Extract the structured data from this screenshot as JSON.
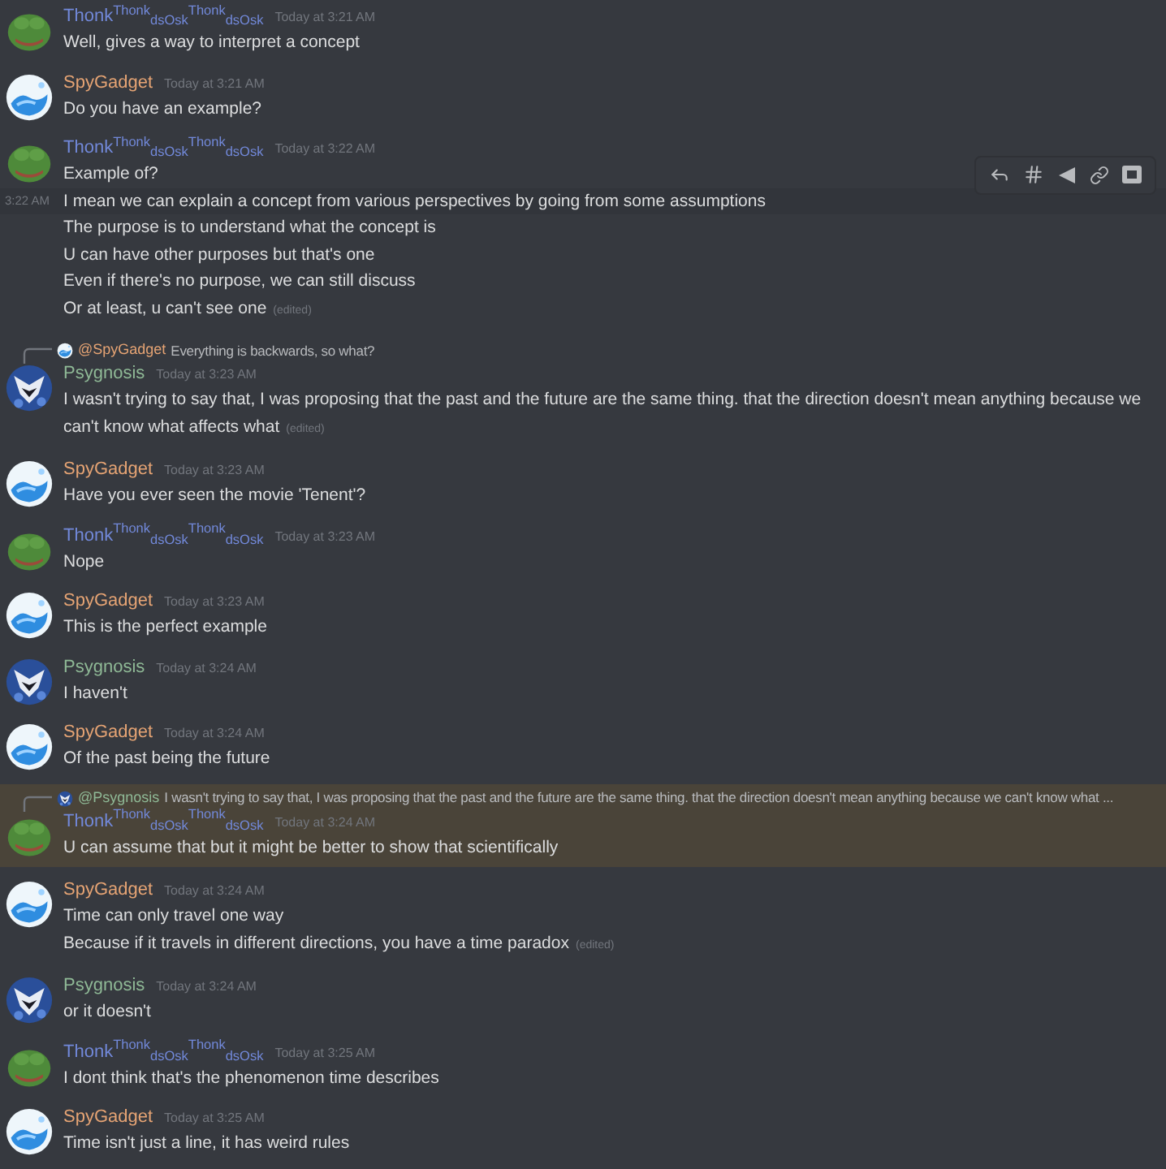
{
  "messages": [
    {
      "author": "Thonk$^{Thonk}$$_{dsOsk}$$^{Thonk}$$_{dsOsk}$",
      "color": "#7289da",
      "kind": "frog",
      "time": "Today at 3:21 AM",
      "highlighted": false,
      "lines": [
        {
          "text": "Well, gives a way to interpret a concept",
          "hovered": false
        }
      ]
    },
    {
      "author": "SpyGadget",
      "color": "#e6a474",
      "kind": "water",
      "time": "Today at 3:21 AM",
      "highlighted": false,
      "lines": [
        {
          "text": "Do you have an example?",
          "hovered": false
        }
      ]
    },
    {
      "author": "Thonk$^{Thonk}$$_{dsOsk}$$^{Thonk}$$_{dsOsk}$",
      "color": "#7289da",
      "kind": "frog",
      "time": "Today at 3:22 AM",
      "highlighted": false,
      "lines": [
        {
          "text": "Example of?",
          "hovered": false
        },
        {
          "text": "I mean we can explain a concept from various perspectives by going from some assumptions",
          "hovered": true,
          "side_time": "3:22 AM"
        },
        {
          "text": "The purpose is to understand what the concept is",
          "hovered": false
        },
        {
          "text": "U can have other purposes but that's one",
          "hovered": false
        },
        {
          "text": "Even if there's no purpose, we can still discuss",
          "hovered": false
        },
        {
          "text": "Or at least, u can't see one",
          "hovered": false,
          "edited_tag": "(edited)"
        }
      ]
    },
    {
      "reply": {
        "author": "@SpyGadget",
        "color": "#e6a474",
        "kind": "water",
        "text": "Everything is backwards, so what?"
      },
      "author": "Psygnosis",
      "color": "#8fb996",
      "kind": "owl",
      "time": "Today at 3:23 AM",
      "highlighted": false,
      "lines": [
        {
          "text": "I wasn't trying to say that, I was proposing that the past and the future are the same thing. that the direction doesn't mean anything because we can't know what affects what",
          "hovered": false,
          "edited_tag": "(edited)"
        }
      ]
    },
    {
      "author": "SpyGadget",
      "color": "#e6a474",
      "kind": "water",
      "time": "Today at 3:23 AM",
      "highlighted": false,
      "lines": [
        {
          "text": "Have you ever seen the movie 'Tenent'?",
          "hovered": false
        }
      ]
    },
    {
      "author": "Thonk$^{Thonk}$$_{dsOsk}$$^{Thonk}$$_{dsOsk}$",
      "color": "#7289da",
      "kind": "frog",
      "time": "Today at 3:23 AM",
      "highlighted": false,
      "lines": [
        {
          "text": "Nope",
          "hovered": false
        }
      ]
    },
    {
      "author": "SpyGadget",
      "color": "#e6a474",
      "kind": "water",
      "time": "Today at 3:23 AM",
      "highlighted": false,
      "lines": [
        {
          "text": "This is the perfect example",
          "hovered": false
        }
      ]
    },
    {
      "author": "Psygnosis",
      "color": "#8fb996",
      "kind": "owl",
      "time": "Today at 3:24 AM",
      "highlighted": false,
      "lines": [
        {
          "text": "I haven't",
          "hovered": false
        }
      ]
    },
    {
      "author": "SpyGadget",
      "color": "#e6a474",
      "kind": "water",
      "time": "Today at 3:24 AM",
      "highlighted": false,
      "lines": [
        {
          "text": "Of the past being the future",
          "hovered": false
        }
      ]
    },
    {
      "reply": {
        "author": "@Psygnosis",
        "color": "#8fb996",
        "kind": "owl",
        "text": "I wasn't trying to say that, I was proposing that the past and the future are the same thing. that the direction doesn't mean anything because we can't know what ..."
      },
      "author": "Thonk$^{Thonk}$$_{dsOsk}$$^{Thonk}$$_{dsOsk}$",
      "color": "#7289da",
      "kind": "frog",
      "time": "Today at 3:24 AM",
      "highlighted": true,
      "lines": [
        {
          "text": "U can assume that but it might be better to show that scientifically",
          "hovered": false
        }
      ]
    },
    {
      "author": "SpyGadget",
      "color": "#e6a474",
      "kind": "water",
      "time": "Today at 3:24 AM",
      "highlighted": false,
      "lines": [
        {
          "text": "Time can only travel one way",
          "hovered": false
        },
        {
          "text": "Because if it travels in different directions, you have a time paradox",
          "hovered": false,
          "edited_tag": "(edited)"
        }
      ]
    },
    {
      "author": "Psygnosis",
      "color": "#8fb996",
      "kind": "owl",
      "time": "Today at 3:24 AM",
      "highlighted": false,
      "lines": [
        {
          "text": "or it doesn't",
          "hovered": false
        }
      ]
    },
    {
      "author": "Thonk$^{Thonk}$$_{dsOsk}$$^{Thonk}$$_{dsOsk}$",
      "color": "#7289da",
      "kind": "frog",
      "time": "Today at 3:25 AM",
      "highlighted": false,
      "lines": [
        {
          "text": "I dont think that's the phenomenon time describes",
          "hovered": false
        }
      ]
    },
    {
      "author": "SpyGadget",
      "color": "#e6a474",
      "kind": "water",
      "time": "Today at 3:25 AM",
      "highlighted": false,
      "lines": [
        {
          "text": "Time isn't just a line, it has weird rules",
          "hovered": false
        }
      ]
    }
  ]
}
